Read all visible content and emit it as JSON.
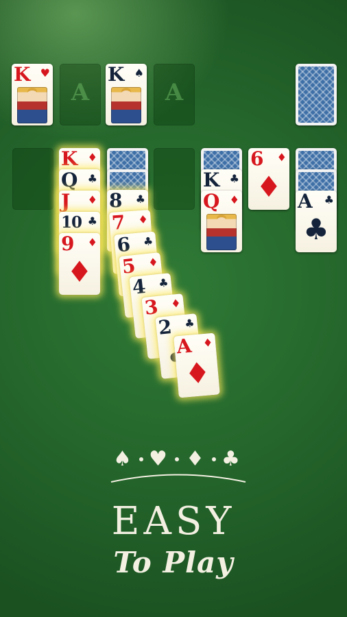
{
  "foundation": [
    {
      "type": "card",
      "rank": "K",
      "suit": "♥",
      "color": "red",
      "face": true
    },
    {
      "type": "slot",
      "label": "A"
    },
    {
      "type": "card",
      "rank": "K",
      "suit": "♠",
      "color": "black",
      "face": true
    },
    {
      "type": "slot",
      "label": "A"
    }
  ],
  "stock": {
    "type": "back"
  },
  "tableau": [
    {
      "type": "slot"
    },
    {
      "cards": [
        {
          "rank": "K",
          "suit": "♦",
          "color": "red",
          "glow": true
        },
        {
          "rank": "Q",
          "suit": "♣",
          "color": "black",
          "glow": true
        },
        {
          "rank": "J",
          "suit": "♦",
          "color": "red",
          "glow": true
        },
        {
          "rank": "10",
          "suit": "♣",
          "color": "black",
          "glow": true
        },
        {
          "rank": "9",
          "suit": "♦",
          "color": "red",
          "glow": true
        }
      ]
    },
    {
      "backs": 2,
      "cards": [
        {
          "rank": "8",
          "suit": "♣",
          "color": "black",
          "glow": true
        },
        {
          "rank": "7",
          "suit": "♦",
          "color": "red",
          "glow": true
        },
        {
          "rank": "6",
          "suit": "♣",
          "color": "black",
          "glow": true
        },
        {
          "rank": "5",
          "suit": "♦",
          "color": "red",
          "glow": true
        },
        {
          "rank": "4",
          "suit": "♣",
          "color": "black",
          "glow": true
        },
        {
          "rank": "3",
          "suit": "♦",
          "color": "red",
          "glow": true
        },
        {
          "rank": "2",
          "suit": "♣",
          "color": "black",
          "glow": true
        },
        {
          "rank": "A",
          "suit": "♦",
          "color": "red",
          "glow": true
        }
      ]
    },
    {
      "type": "slot"
    },
    {
      "backs": 1,
      "cards": [
        {
          "rank": "K",
          "suit": "♣",
          "color": "black"
        },
        {
          "rank": "Q",
          "suit": "♦",
          "color": "red",
          "face": true
        }
      ]
    },
    {
      "cards": [
        {
          "rank": "6",
          "suit": "♦",
          "color": "red"
        }
      ]
    },
    {
      "backs": 2,
      "cards": [
        {
          "rank": "A",
          "suit": "♣",
          "color": "black"
        }
      ]
    }
  ],
  "deco_suits": [
    "♠",
    "♥",
    "♦",
    "♣"
  ],
  "headline": "EASY",
  "subline": "To Play",
  "colors": {
    "felt": "#23632a",
    "red": "#d7171e",
    "black": "#14233a",
    "glow": "#ffeb5a",
    "text": "#f3f0e2"
  }
}
